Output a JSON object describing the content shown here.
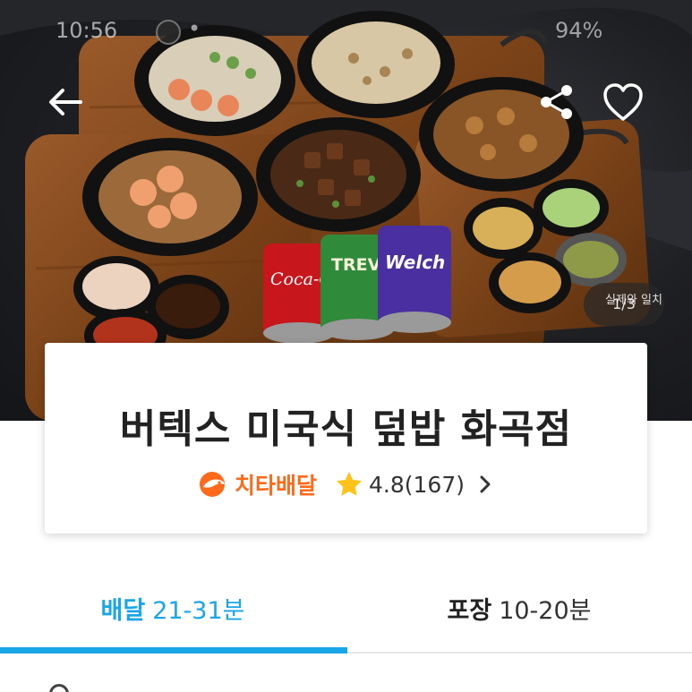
{
  "status_bar": {
    "time": "10:56",
    "indicator": "•",
    "battery": "94%"
  },
  "hero": {
    "photo_counter": "1/3",
    "photo_caption": "실제와 일치",
    "can_labels": [
      "Coca-Cola",
      "TREVI",
      "Welch's"
    ]
  },
  "store": {
    "name": "버텍스 미국식 덮밥 화곡점",
    "delivery_service": "치타배달",
    "rating": "4.8(167)",
    "colors": {
      "cheetah_orange": "#ff6a1a",
      "star_yellow": "#ffc21a"
    }
  },
  "tabs": [
    {
      "name": "배달",
      "time": "21-31분",
      "active": true
    },
    {
      "name": "포장",
      "time": "10-20분",
      "active": false
    }
  ],
  "theme": {
    "accent": "#1aa6e6",
    "text": "#222222"
  },
  "icons": [
    "back-arrow-icon",
    "share-icon",
    "heart-icon",
    "cheetah-logo-icon",
    "star-icon",
    "chevron-right-icon"
  ]
}
